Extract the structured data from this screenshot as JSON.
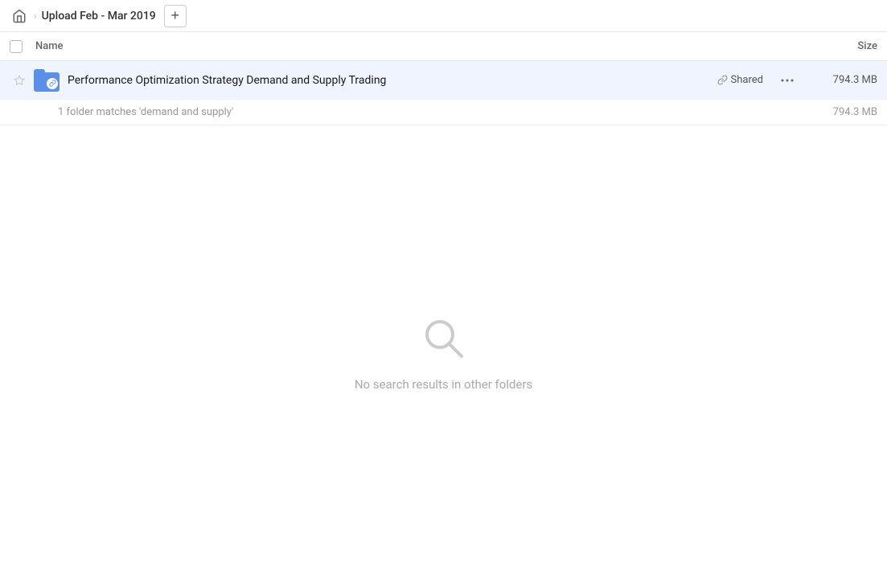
{
  "breadcrumb": {
    "home_label": "Home",
    "path_item": "Upload Feb - Mar 2019",
    "add_button_label": "+"
  },
  "columns": {
    "name_label": "Name",
    "size_label": "Size"
  },
  "file_row": {
    "name": "Performance Optimization Strategy Demand and Supply Trading",
    "shared_label": "Shared",
    "size": "794.3 MB"
  },
  "summary": {
    "text": "1 folder matches 'demand and supply'",
    "size": "794.3 MB"
  },
  "empty_state": {
    "message": "No search results in other folders"
  },
  "icons": {
    "home": "⌂",
    "chevron": "›",
    "star": "☆",
    "link": "🔗",
    "more": "•••"
  }
}
